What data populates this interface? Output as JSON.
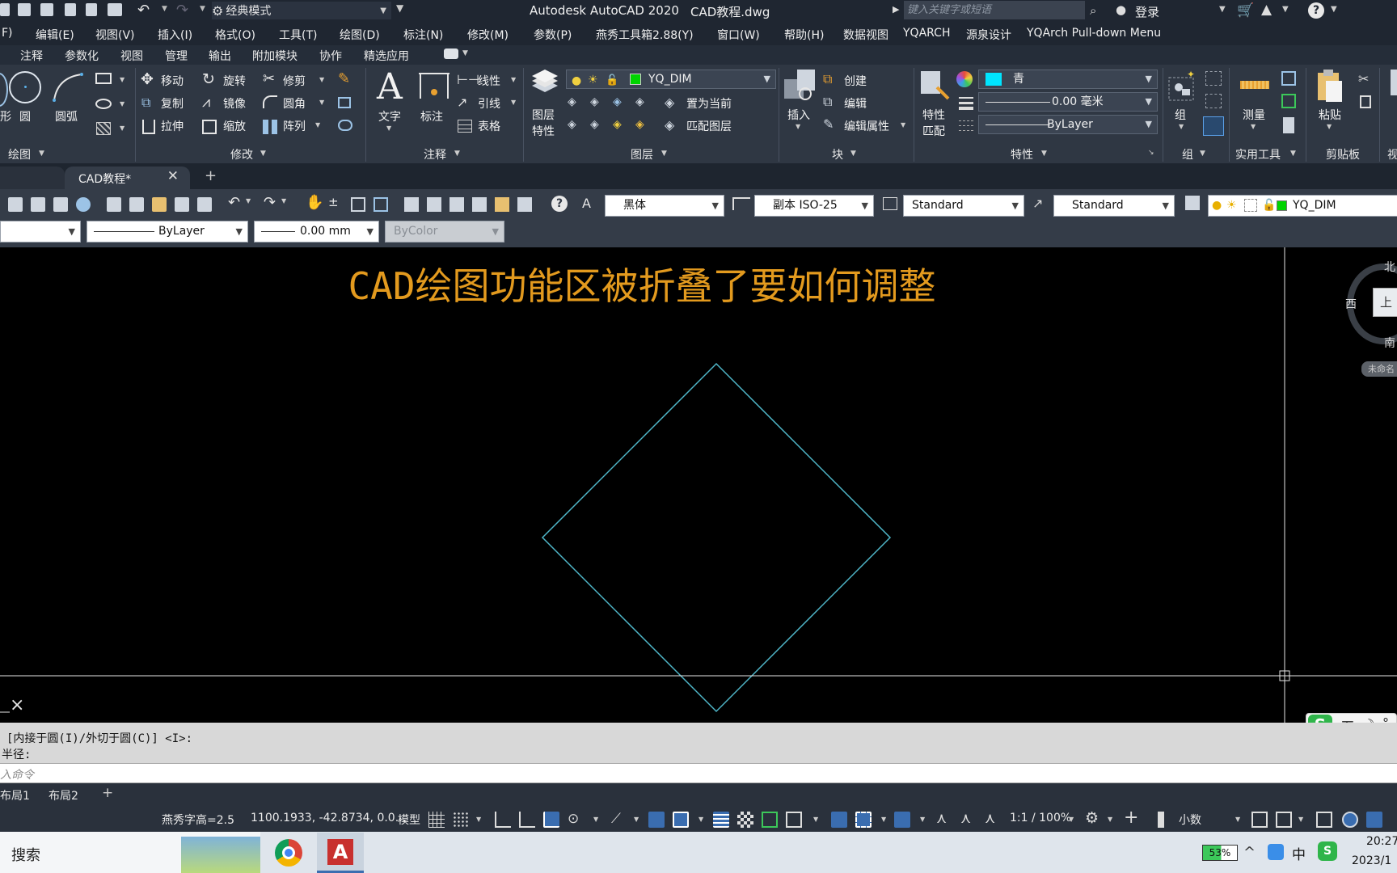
{
  "title_bar": {
    "workspace": "经典模式",
    "app_title": "Autodesk AutoCAD 2020",
    "file_name": "CAD教程.dwg",
    "search_placeholder": "键入关键字或短语",
    "login": "登录"
  },
  "menu_bar": [
    "F)",
    "编辑(E)",
    "视图(V)",
    "插入(I)",
    "格式(O)",
    "工具(T)",
    "绘图(D)",
    "标注(N)",
    "修改(M)",
    "参数(P)",
    "燕秀工具箱2.88(Y)",
    "窗口(W)",
    "帮助(H)",
    "数据视图",
    "YQARCH",
    "源泉设计",
    "YQArch Pull-down Menu"
  ],
  "ribbon_tabs": [
    "注释",
    "参数化",
    "视图",
    "管理",
    "输出",
    "附加模块",
    "协作",
    "精选应用"
  ],
  "ribbon": {
    "draw": {
      "title": "绘图",
      "circle": "圆",
      "arc": "圆弧",
      "partial": "形"
    },
    "modify": {
      "title": "修改",
      "move": "移动",
      "rotate": "旋转",
      "trim": "修剪",
      "copy": "复制",
      "mirror": "镜像",
      "fillet": "圆角",
      "stretch": "拉伸",
      "scale": "缩放",
      "array": "阵列"
    },
    "annotation": {
      "title": "注释",
      "text": "文字",
      "dimension": "标注",
      "linear": "线性",
      "leader": "引线",
      "table": "表格"
    },
    "layers": {
      "title": "图层",
      "layer_props_1": "图层",
      "layer_props_2": "特性",
      "current_layer": "YQ_DIM",
      "set_current": "置为当前",
      "match_layer": "匹配图层"
    },
    "block": {
      "title": "块",
      "insert": "插入",
      "create": "创建",
      "edit": "编辑",
      "edit_attr": "编辑属性"
    },
    "properties": {
      "title": "特性",
      "match_1": "特性",
      "match_2": "匹配",
      "color": "青",
      "lineweight": "0.00 毫米",
      "linetype": "ByLayer"
    },
    "group": {
      "title": "组",
      "group": "组"
    },
    "utilities": {
      "title": "实用工具",
      "measure": "测量"
    },
    "clipboard": {
      "title": "剪贴板",
      "paste": "粘贴"
    },
    "view_partial": "视"
  },
  "doc_tab": {
    "name": "CAD教程*"
  },
  "toolbar": {
    "text_style": "黑体",
    "dim_style": "副本 ISO-25",
    "table_style": "Standard",
    "mleader_style": "Standard",
    "layer": "YQ_DIM",
    "linetype": "ByLayer",
    "lineweight": "0.00 mm",
    "plot_style": "ByColor"
  },
  "canvas": {
    "heading": "CAD绘图功能区被折叠了要如何调整",
    "viewcube": {
      "north": "北",
      "west": "西",
      "south": "南",
      "top": "上",
      "unnamed": "未命名"
    },
    "x_mark": "×"
  },
  "command": {
    "line1": "[内接于圆(I)/外切于圆(C)] <I>:",
    "line2": "半径:",
    "input_placeholder": "入命令"
  },
  "layout_tabs": [
    "布局1",
    "布局2"
  ],
  "status": {
    "text_height": "燕秀字高=2.5",
    "coordinates": "1100.1933, -42.8734, 0.0...",
    "model": "模型",
    "scale": "1:1 / 100%",
    "units": "小数"
  },
  "taskbar": {
    "search": "搜索",
    "battery": "53%",
    "ime": "中",
    "time": "20:27",
    "date": "2023/1"
  },
  "ime_bar": {
    "mode": "五"
  },
  "colors": {
    "accent": "#3a6db0",
    "drawing_line": "#4fb6c8",
    "heading": "#e39a1e",
    "canvas": "#000000"
  }
}
